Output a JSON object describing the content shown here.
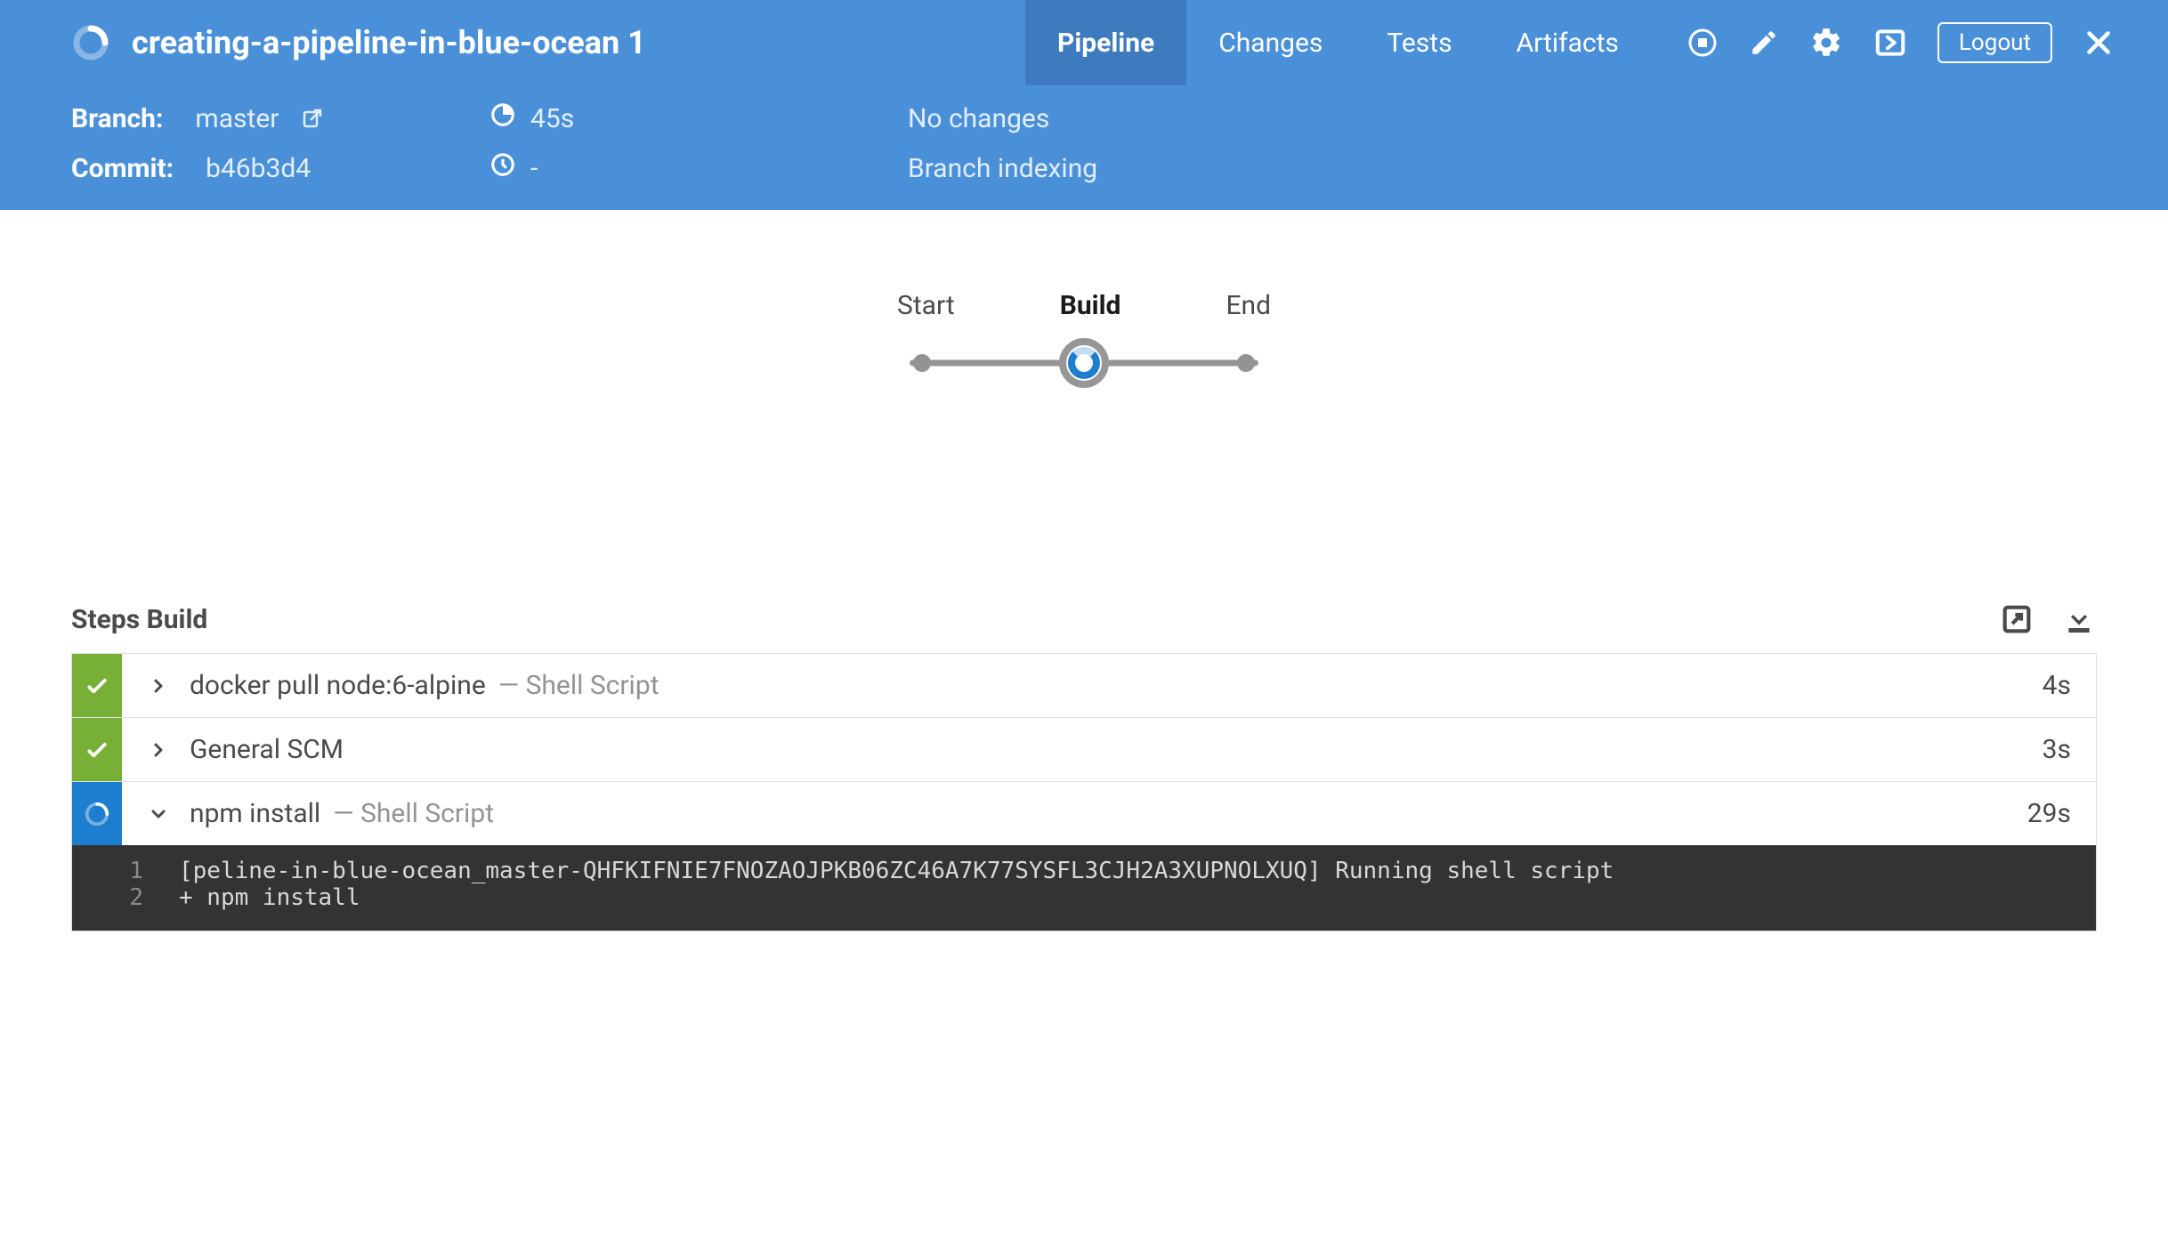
{
  "header": {
    "title": "creating-a-pipeline-in-blue-ocean 1",
    "tabs": [
      {
        "label": "Pipeline",
        "active": true
      },
      {
        "label": "Changes",
        "active": false
      },
      {
        "label": "Tests",
        "active": false
      },
      {
        "label": "Artifacts",
        "active": false
      }
    ],
    "logout_label": "Logout"
  },
  "info": {
    "branch_label": "Branch:",
    "branch_value": "master",
    "commit_label": "Commit:",
    "commit_value": "b46b3d4",
    "duration_value": "45s",
    "clock_value": "-",
    "changes_text": "No changes",
    "cause_text": "Branch indexing"
  },
  "graph": {
    "nodes": [
      "Start",
      "Build",
      "End"
    ],
    "active_index": 1
  },
  "steps": {
    "title": "Steps Build",
    "items": [
      {
        "status": "success",
        "expanded": false,
        "label": "docker pull node:6-alpine",
        "meta": "— Shell Script",
        "time": "4s"
      },
      {
        "status": "success",
        "expanded": false,
        "label": "General SCM",
        "meta": "",
        "time": "3s"
      },
      {
        "status": "running",
        "expanded": true,
        "label": "npm install",
        "meta": "— Shell Script",
        "time": "29s"
      }
    ],
    "console": [
      {
        "n": "1",
        "t": "[peline-in-blue-ocean_master-QHFKIFNIE7FNOZAOJPKB06ZC46A7K77SYSFL3CJH2A3XUPNOLXUQ] Running shell script"
      },
      {
        "n": "2",
        "t": "+ npm install"
      }
    ]
  }
}
